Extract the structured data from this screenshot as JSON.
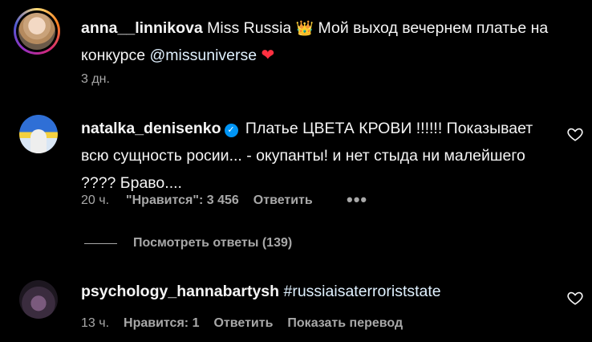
{
  "caption": {
    "username": "anna__linnikova",
    "text_before": "Miss Russia",
    "crown_emoji": "👑",
    "text_after": "Мой выход вечернем платье на конкурсе",
    "mention": "@missuniverse",
    "heart_emoji": "❤",
    "time": "3 дн."
  },
  "comments": [
    {
      "username": "natalka_denisenko",
      "verified_mark": "✓",
      "text": "Платье ЦВЕТА КРОВИ !!!!!! Показывает всю сущность росии... - окупанты! и нет стыда ни малейшего ???? Браво....",
      "time": "20 ч.",
      "likes": "\"Нравится\": 3 456",
      "reply": "Ответить",
      "more": "•••",
      "view_replies": "Посмотреть ответы (139)"
    },
    {
      "username": "psychology_hannabartysh",
      "text": "#russiaisaterroriststate",
      "time": "13 ч.",
      "likes": "Нравится: 1",
      "reply": "Ответить",
      "translate": "Показать перевод"
    }
  ],
  "icons": {
    "like": "heart-outline-icon"
  },
  "colors": {
    "background": "#000000",
    "text": "#f5f5f5",
    "secondary": "#a8a8a8",
    "verified": "#0095f6",
    "heart": "#ff3040"
  }
}
